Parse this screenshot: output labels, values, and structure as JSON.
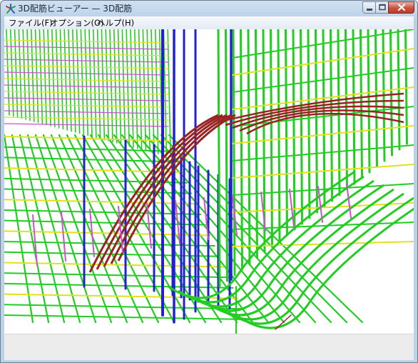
{
  "window": {
    "title": "3D配筋ビューアー — 3D配筋",
    "icon": "app-star-icon"
  },
  "controls": {
    "minimize": "minimize-icon",
    "maximize": "maximize-icon",
    "close": "close-icon"
  },
  "menu": {
    "file": "ファイル(F)",
    "options": "オプション(O)",
    "help": "ヘルプ(H)"
  },
  "colors": {
    "green_rebar": "#22cc22",
    "blue_rebar": "#2222cc",
    "yellow_rebar": "#e0e020",
    "magenta_rebar": "#d050d0",
    "red_rebar": "#992222"
  }
}
